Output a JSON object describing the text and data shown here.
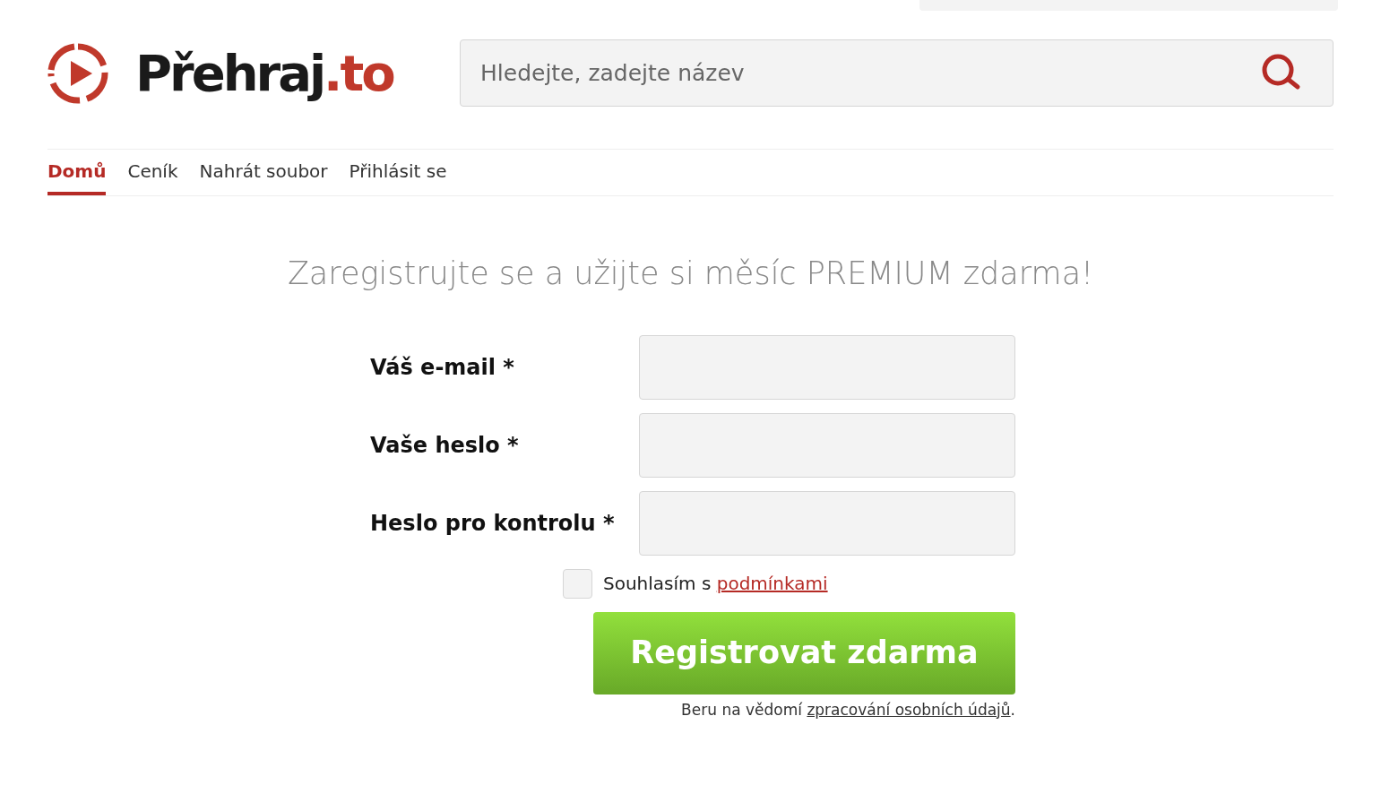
{
  "logo": {
    "name": "Přehraj",
    "suffix": ".to"
  },
  "search": {
    "placeholder": "Hledejte, zadejte název"
  },
  "nav": [
    {
      "label": "Domů",
      "selected": true
    },
    {
      "label": "Ceník",
      "selected": false
    },
    {
      "label": "Nahrát soubor",
      "selected": false
    },
    {
      "label": "Přihlásit se",
      "selected": false
    }
  ],
  "heading": "Zaregistrujte se a užijte si měsíc PREMIUM zdarma!",
  "fields": [
    {
      "label": "Váš e-mail *"
    },
    {
      "label": "Vaše heslo *"
    },
    {
      "label": "Heslo pro kontrolu *"
    }
  ],
  "agree": {
    "text": "Souhlasím s ",
    "link": "podmínkami",
    "checked": false
  },
  "submit": "Registrovat zdarma",
  "privacy": {
    "text": "Beru na vědomí ",
    "link": "zpracování osobních údajů",
    "end": "."
  }
}
